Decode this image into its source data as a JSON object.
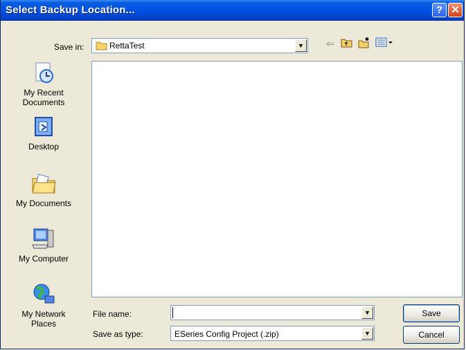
{
  "window": {
    "title": "Select Backup Location...",
    "help_glyph": "?",
    "close_glyph": "✕"
  },
  "toolbar": {
    "save_in_label": "Save in:",
    "current_folder": "RettaTest",
    "back_icon": "back-arrow-icon",
    "up_icon": "up-folder-icon",
    "new_folder_icon": "new-folder-icon",
    "views_icon": "views-menu-icon"
  },
  "places": [
    {
      "label": "My Recent Documents",
      "icon": "recent-documents-icon"
    },
    {
      "label": "Desktop",
      "icon": "desktop-icon"
    },
    {
      "label": "My Documents",
      "icon": "my-documents-icon"
    },
    {
      "label": "My Computer",
      "icon": "my-computer-icon"
    },
    {
      "label": "My Network Places",
      "icon": "network-places-icon"
    }
  ],
  "form": {
    "file_name_label": "File name:",
    "file_name_value": "",
    "save_as_type_label": "Save as type:",
    "save_as_type_value": "ESeries Config Project (.zip)"
  },
  "buttons": {
    "save": "Save",
    "cancel": "Cancel"
  },
  "colors": {
    "titlebar": "#0053e3",
    "dialog_bg": "#ece9d8"
  }
}
